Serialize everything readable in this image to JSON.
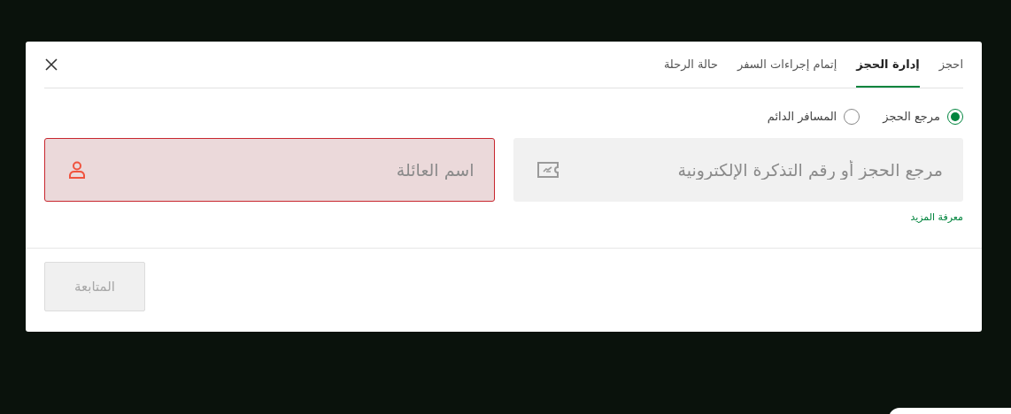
{
  "tabs": [
    {
      "label": "احجز",
      "selected": false
    },
    {
      "label": "إدارة الحجز",
      "selected": true
    },
    {
      "label": "إتمام إجراءات السفر",
      "selected": false
    },
    {
      "label": "حالة الرحلة",
      "selected": false
    }
  ],
  "search_type": [
    {
      "label": "مرجع الحجز",
      "selected": true
    },
    {
      "label": "المسافر الدائم",
      "selected": false
    }
  ],
  "fields": [
    {
      "kind": "ticket",
      "placeholder": "مرجع الحجز أو رقم التذكرة الإلكترونية",
      "error": false
    },
    {
      "kind": "person",
      "placeholder": "اسم العائلة",
      "error": true
    }
  ],
  "learn_more_link": "معرفة المزيد",
  "continue_button": {
    "label": "المتابعة",
    "disabled": true
  }
}
